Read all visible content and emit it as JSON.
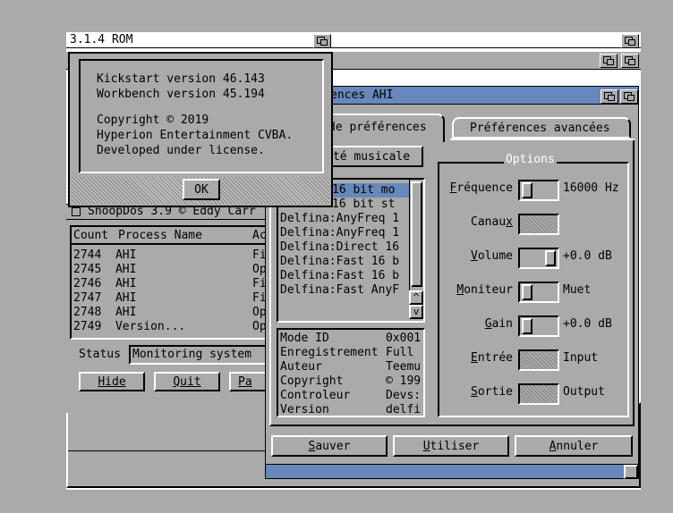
{
  "screen": {
    "title": "3.1.4 ROM"
  },
  "about": {
    "lines": [
      "Kickstart version 46.143",
      "Workbench version 45.194",
      "",
      "Copyright © 2019",
      "Hyperion Entertainment CVBA.",
      "Developed under license."
    ],
    "ok_label": "OK"
  },
  "snoopdos": {
    "title": "SnoopDos 3.9 © Eddy Carr",
    "columns": [
      "Count",
      "Process Name",
      "Ac"
    ],
    "rows": [
      {
        "count": "2744",
        "name": "AHI",
        "act": "Fi"
      },
      {
        "count": "2745",
        "name": "AHI",
        "act": "Op"
      },
      {
        "count": "2746",
        "name": "AHI",
        "act": "Fi"
      },
      {
        "count": "2747",
        "name": "AHI",
        "act": "Fi"
      },
      {
        "count": "2748",
        "name": "AHI",
        "act": "Op"
      },
      {
        "count": "2749",
        "name": "Version...",
        "act": "Op"
      }
    ],
    "status_label": "Status",
    "status_value": "Monitoring system",
    "hide_label": "Hide",
    "quit_label": "Quit",
    "pause_label": "Pa"
  },
  "ahi": {
    "title": "ences AHI",
    "tab_modes": "de préférences",
    "tab_advanced": "Préférences avancées",
    "unit_label": "té musicale",
    "modes": [
      "16 bit mo",
      "16 bit st",
      "Delfina:AnyFreq 1",
      "Delfina:AnyFreq 1",
      "Delfina:Direct 16",
      "Delfina:Fast 16 b",
      "Delfina:Fast 16 b",
      "Delfina:Fast AnyF"
    ],
    "info": [
      {
        "k": "Mode ID",
        "v": "0x001"
      },
      {
        "k": "Enregistrement",
        "v": "Full"
      },
      {
        "k": "Auteur",
        "v": "Teemu"
      },
      {
        "k": "Copyright",
        "v": "© 199"
      },
      {
        "k": "Controleur",
        "v": "Devs:"
      },
      {
        "k": "Version",
        "v": "delfi"
      }
    ],
    "options_title": "Options",
    "frequency": {
      "label": "Fréquence",
      "value": "16000 Hz",
      "level": 0.0
    },
    "channels": {
      "label": "Canaux"
    },
    "volume": {
      "label": "Volume",
      "value": "+0.0 dB",
      "level": 1.0
    },
    "monitor": {
      "label": "Moniteur",
      "value": "Muet",
      "level": 0.0
    },
    "gain": {
      "label": "Gain",
      "value": "+0.0 dB",
      "level": 0.0
    },
    "input": {
      "label": "Entrée",
      "value": "Input"
    },
    "output": {
      "label": "Sortie",
      "value": "Output"
    },
    "save_label": "Sauver",
    "use_label": "Utiliser",
    "cancel_label": "Annuler"
  }
}
